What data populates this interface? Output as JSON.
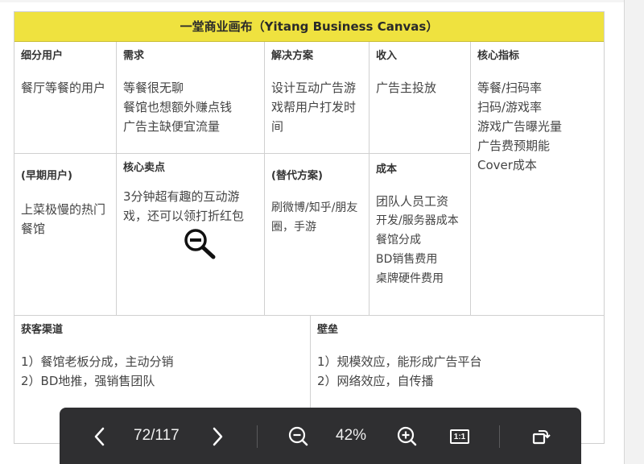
{
  "canvas": {
    "title": "一堂商业画布（Yitang Business Canvas）",
    "segments": {
      "header": "细分用户",
      "content": "餐厅等餐的用户"
    },
    "early_users": {
      "header": "(早期用户)",
      "content": "上菜极慢的热门餐馆"
    },
    "needs": {
      "header": "需求",
      "content": "等餐很无聊\n餐馆也想额外赚点钱\n广告主缺便宜流量"
    },
    "usp": {
      "header": "核心卖点",
      "content": "3分钟超有趣的互动游戏，还可以领打折红包"
    },
    "solution": {
      "header": "解决方案",
      "content": "设计互动广告游戏帮用户打发时间"
    },
    "alternatives": {
      "header": "(替代方案)",
      "content": "刷微博/知乎/朋友圈，手游"
    },
    "revenue": {
      "header": "收入",
      "content": "广告主投放"
    },
    "cost": {
      "header": "成本",
      "lines": [
        "团队人员工资",
        "开发/服务器成本",
        "餐馆分成",
        "BD销售费用",
        "桌牌硬件费用"
      ]
    },
    "metrics": {
      "header": "核心指标",
      "content": "等餐/扫码率\n扫码/游戏率\n游戏广告曝光量\n广告费预期能Cover成本"
    },
    "channels": {
      "header": "获客渠道",
      "content": "1）餐馆老板分成，主动分销\n2）BD地推，强销售团队"
    },
    "moat": {
      "header": "壁垒",
      "content": "1）规模效应，能形成广告平台\n2）网络效应，自传播"
    }
  },
  "toolbar": {
    "page_indicator": "72/117",
    "zoom_level": "42%",
    "actual_size_label": "1:1",
    "icons": [
      "chevron-left-icon",
      "chevron-right-icon",
      "zoom-out-icon",
      "zoom-in-icon",
      "actual-size-icon",
      "rotate-icon"
    ],
    "bg_color": "#2f2f31"
  },
  "colors": {
    "title_bg": "#efe23f",
    "border": "#d0d0d0"
  },
  "cursor": {
    "icon": "zoom-out-cursor-icon"
  }
}
